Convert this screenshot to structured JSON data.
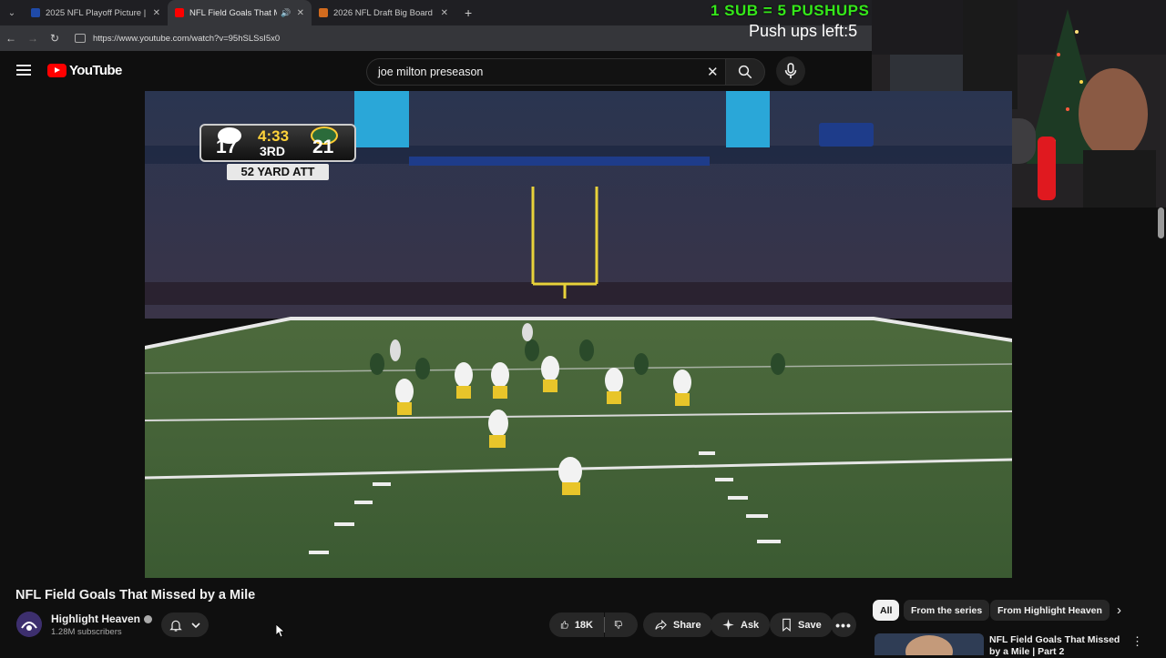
{
  "browser": {
    "tabs": [
      {
        "title": "2025 NFL Playoff Picture | NFL...",
        "active": false,
        "favicon_color": "#1f4aa8"
      },
      {
        "title": "NFL Field Goals That Missed by a Mile",
        "active": true,
        "favicon_color": "#ff0000"
      },
      {
        "title": "2026 NFL Draft Big Board | Tank...",
        "active": false,
        "favicon_color": "#d26b1e"
      }
    ],
    "url": "https://www.youtube.com/watch?v=95hSLSsI5x0"
  },
  "overlay": {
    "sub_banner": "1 SUB = 5 PUSHUPS",
    "pushups_left": "Push ups left:5"
  },
  "masthead": {
    "logo_text": "YouTube",
    "search_value": "joe milton preseason"
  },
  "video": {
    "scorebug": {
      "away_score": "17",
      "home_score": "21",
      "clock": "4:33",
      "quarter": "3RD",
      "situation": "52 YARD ATT"
    },
    "title": "NFL Field Goals That Missed by a Mile",
    "channel_name": "Highlight Heaven",
    "subscribers": "1.28M subscribers",
    "like_count": "18K",
    "share_label": "Share",
    "ask_label": "Ask",
    "save_label": "Save"
  },
  "chips": [
    "All",
    "From the series",
    "From Highlight Heaven"
  ],
  "recommendation": {
    "title": "NFL Field Goals That Missed by a Mile | Part 2"
  },
  "colors": {
    "accent_red": "#ff0000",
    "banner_green": "#35e81a",
    "background": "#0f0f0f"
  }
}
